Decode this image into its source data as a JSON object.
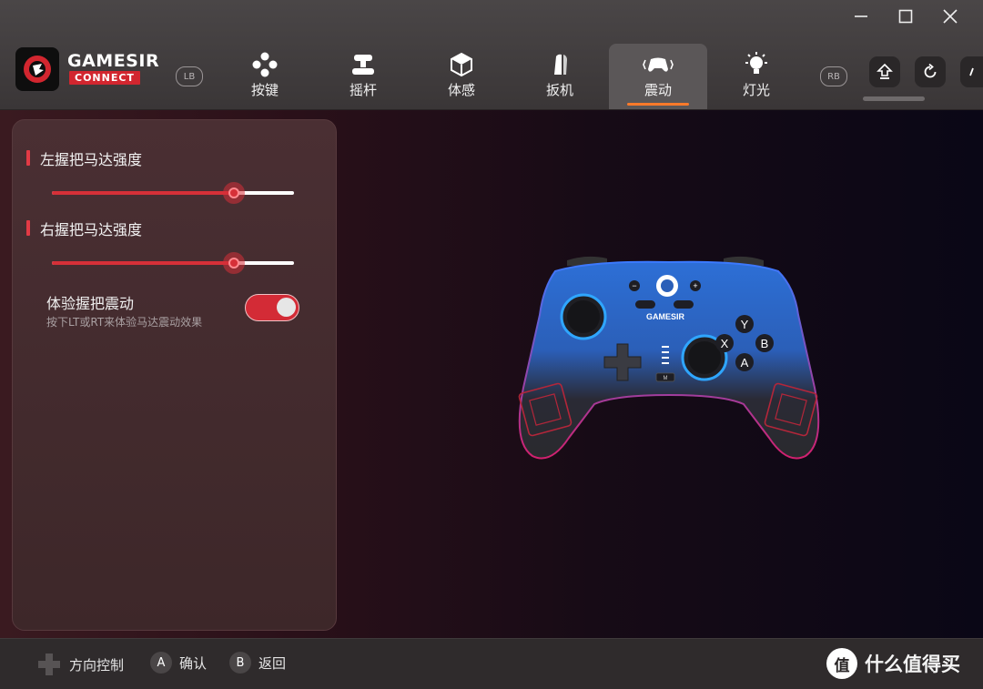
{
  "brand": {
    "name_top": "GAMESIR",
    "name_bottom": "CONNECT"
  },
  "window": {
    "minimize": "—",
    "maximize": "☐",
    "close": "✕"
  },
  "shoulder": {
    "left": "LB",
    "right": "RB"
  },
  "tabs": [
    {
      "label": "按键",
      "icon": "gamepad-buttons-icon"
    },
    {
      "label": "摇杆",
      "icon": "joystick-icon"
    },
    {
      "label": "体感",
      "icon": "motion-cube-icon"
    },
    {
      "label": "扳机",
      "icon": "trigger-icon"
    },
    {
      "label": "震动",
      "icon": "vibration-controller-icon",
      "active": true
    },
    {
      "label": "灯光",
      "icon": "light-bulb-icon"
    }
  ],
  "panel": {
    "left_motor": {
      "title": "左握把马达强度",
      "value": 0.75
    },
    "right_motor": {
      "title": "右握把马达强度",
      "value": 0.75
    },
    "experience": {
      "title": "体验握把震动",
      "subtitle": "按下LT或RT来体验马达震动效果",
      "enabled": true
    }
  },
  "controller": {
    "brand_label": "GAMESIR",
    "buttons": {
      "y": "Y",
      "x": "X",
      "b": "B",
      "a": "A",
      "minus": "−",
      "plus": "+",
      "m": "M"
    }
  },
  "footer": {
    "dpad_hint": "方向控制",
    "a_key": "A",
    "a_hint": "确认",
    "b_key": "B",
    "b_hint": "返回",
    "watermark": "什么值得买",
    "watermark_icon": "值"
  },
  "colors": {
    "accent": "#d63038",
    "tab_underline": "#ff7a2a",
    "brand_red": "#d2262f"
  }
}
